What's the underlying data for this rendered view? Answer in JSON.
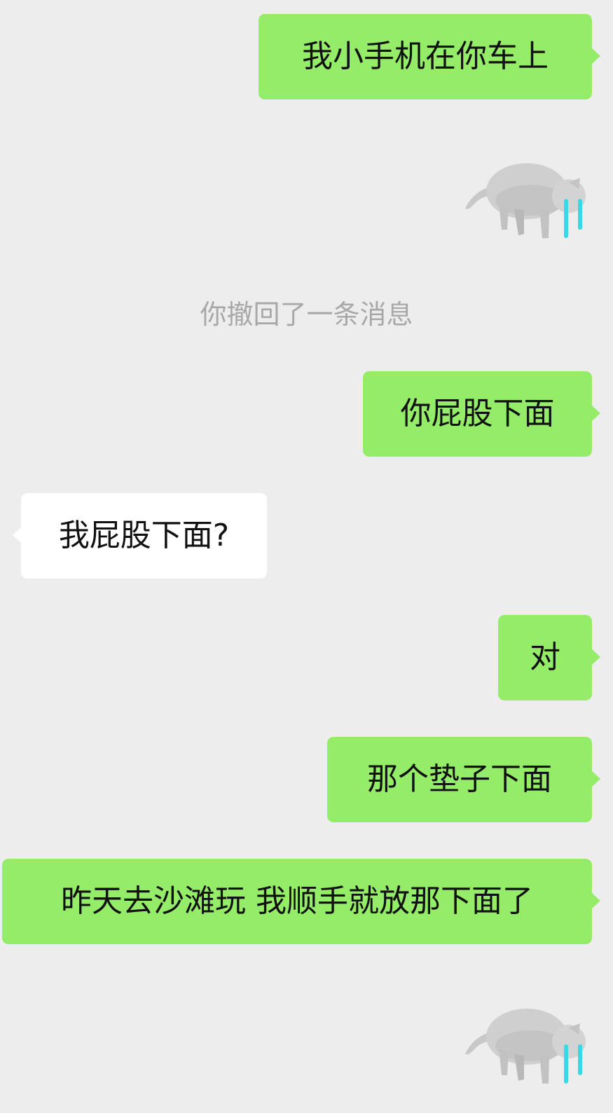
{
  "messages": {
    "m1": "我小手机在你车上",
    "recall_notice": "你撤回了一条消息",
    "m2": "你屁股下面",
    "m3": "我屁股下面?",
    "m4": "对",
    "m5": "那个垫子下面",
    "m6": "昨天去沙滩玩 我顺手就放那下面了"
  },
  "stickers": {
    "s1": "crying-cat-sticker",
    "s2": "crying-cat-sticker"
  },
  "colors": {
    "background": "#ededed",
    "sent_bubble": "#95ec69",
    "received_bubble": "#ffffff",
    "system_text": "#a8a8a8",
    "tear": "#35d9e8"
  }
}
